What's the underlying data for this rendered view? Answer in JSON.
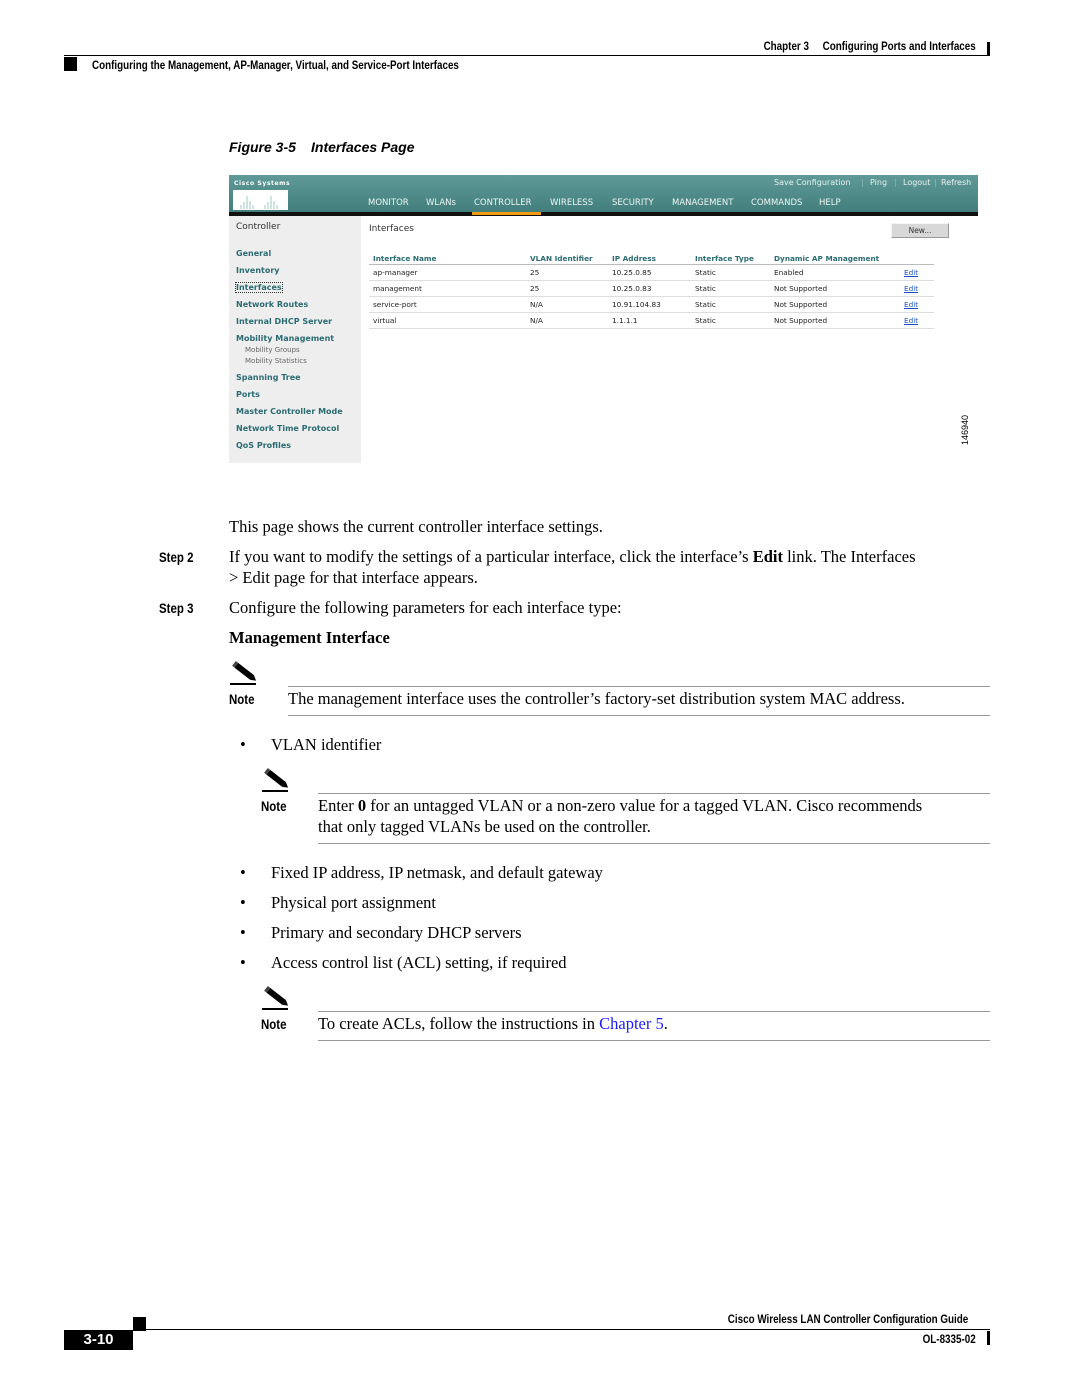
{
  "header": {
    "chapter": "Chapter 3",
    "chapter_title": "Configuring Ports and Interfaces",
    "section": "Configuring the Management, AP-Manager, Virtual, and Service-Port Interfaces"
  },
  "figure": {
    "number": "Figure 3-5",
    "title": "Interfaces Page",
    "id": "146940",
    "screenshot": {
      "logo_text": "Cisco Systems",
      "utility_links": [
        "Save Configuration",
        "Ping",
        "Logout",
        "Refresh"
      ],
      "nav_tabs": [
        "MONITOR",
        "WLANs",
        "CONTROLLER",
        "WIRELESS",
        "SECURITY",
        "MANAGEMENT",
        "COMMANDS",
        "HELP"
      ],
      "active_tab": "CONTROLLER",
      "accent_color": "#f39c12",
      "sidebar": {
        "title": "Controller",
        "items": [
          "General",
          "Inventory",
          "Interfaces",
          "Network Routes",
          "Internal DHCP Server",
          "Mobility Management",
          "Spanning Tree",
          "Ports",
          "Master Controller Mode",
          "Network Time Protocol",
          "QoS Profiles"
        ],
        "subitems": [
          "Mobility Groups",
          "Mobility Statistics"
        ],
        "active_item": "Interfaces"
      },
      "main_title": "Interfaces",
      "new_button": "New...",
      "table": {
        "headers": [
          "Interface Name",
          "VLAN Identifier",
          "IP Address",
          "Interface Type",
          "Dynamic AP Management",
          ""
        ],
        "rows": [
          [
            "ap-manager",
            "25",
            "10.25.0.85",
            "Static",
            "Enabled",
            "Edit"
          ],
          [
            "management",
            "25",
            "10.25.0.83",
            "Static",
            "Not Supported",
            "Edit"
          ],
          [
            "service-port",
            "N/A",
            "10.91.104.83",
            "Static",
            "Not Supported",
            "Edit"
          ],
          [
            "virtual",
            "N/A",
            "1.1.1.1",
            "Static",
            "Not Supported",
            "Edit"
          ]
        ]
      }
    }
  },
  "body": {
    "intro": "This page shows the current controller interface settings.",
    "step2": {
      "label": "Step 2",
      "text_a": "If you want to modify the settings of a particular interface, click the interface’s ",
      "bold": "Edit",
      "text_b": " link. The Interfaces",
      "text_c": "> Edit page for that interface appears."
    },
    "step3": {
      "label": "Step 3",
      "text": "Configure the following parameters for each interface type:"
    },
    "subheading": "Management Interface",
    "note1": {
      "label": "Note",
      "text": "The management interface uses the controller’s factory-set distribution system MAC address."
    },
    "bullet1": "VLAN identifier",
    "note2": {
      "label": "Note",
      "text_a": "Enter ",
      "bold": "0",
      "text_b": " for an untagged VLAN or a non-zero value for a tagged VLAN. Cisco recommends",
      "text_c": "that only tagged VLANs be used on the controller."
    },
    "bullets": [
      "Fixed IP address, IP netmask, and default gateway",
      "Physical port assignment",
      "Primary and secondary DHCP servers",
      "Access control list (ACL) setting, if required"
    ],
    "note3": {
      "label": "Note",
      "text_a": "To create ACLs, follow the instructions in ",
      "link": "Chapter 5",
      "text_b": "."
    },
    "bullet_glyph": "•"
  },
  "footer": {
    "page": "3-10",
    "guide_title": "Cisco Wireless LAN Controller Configuration Guide",
    "doc_number": "OL-8335-02"
  }
}
